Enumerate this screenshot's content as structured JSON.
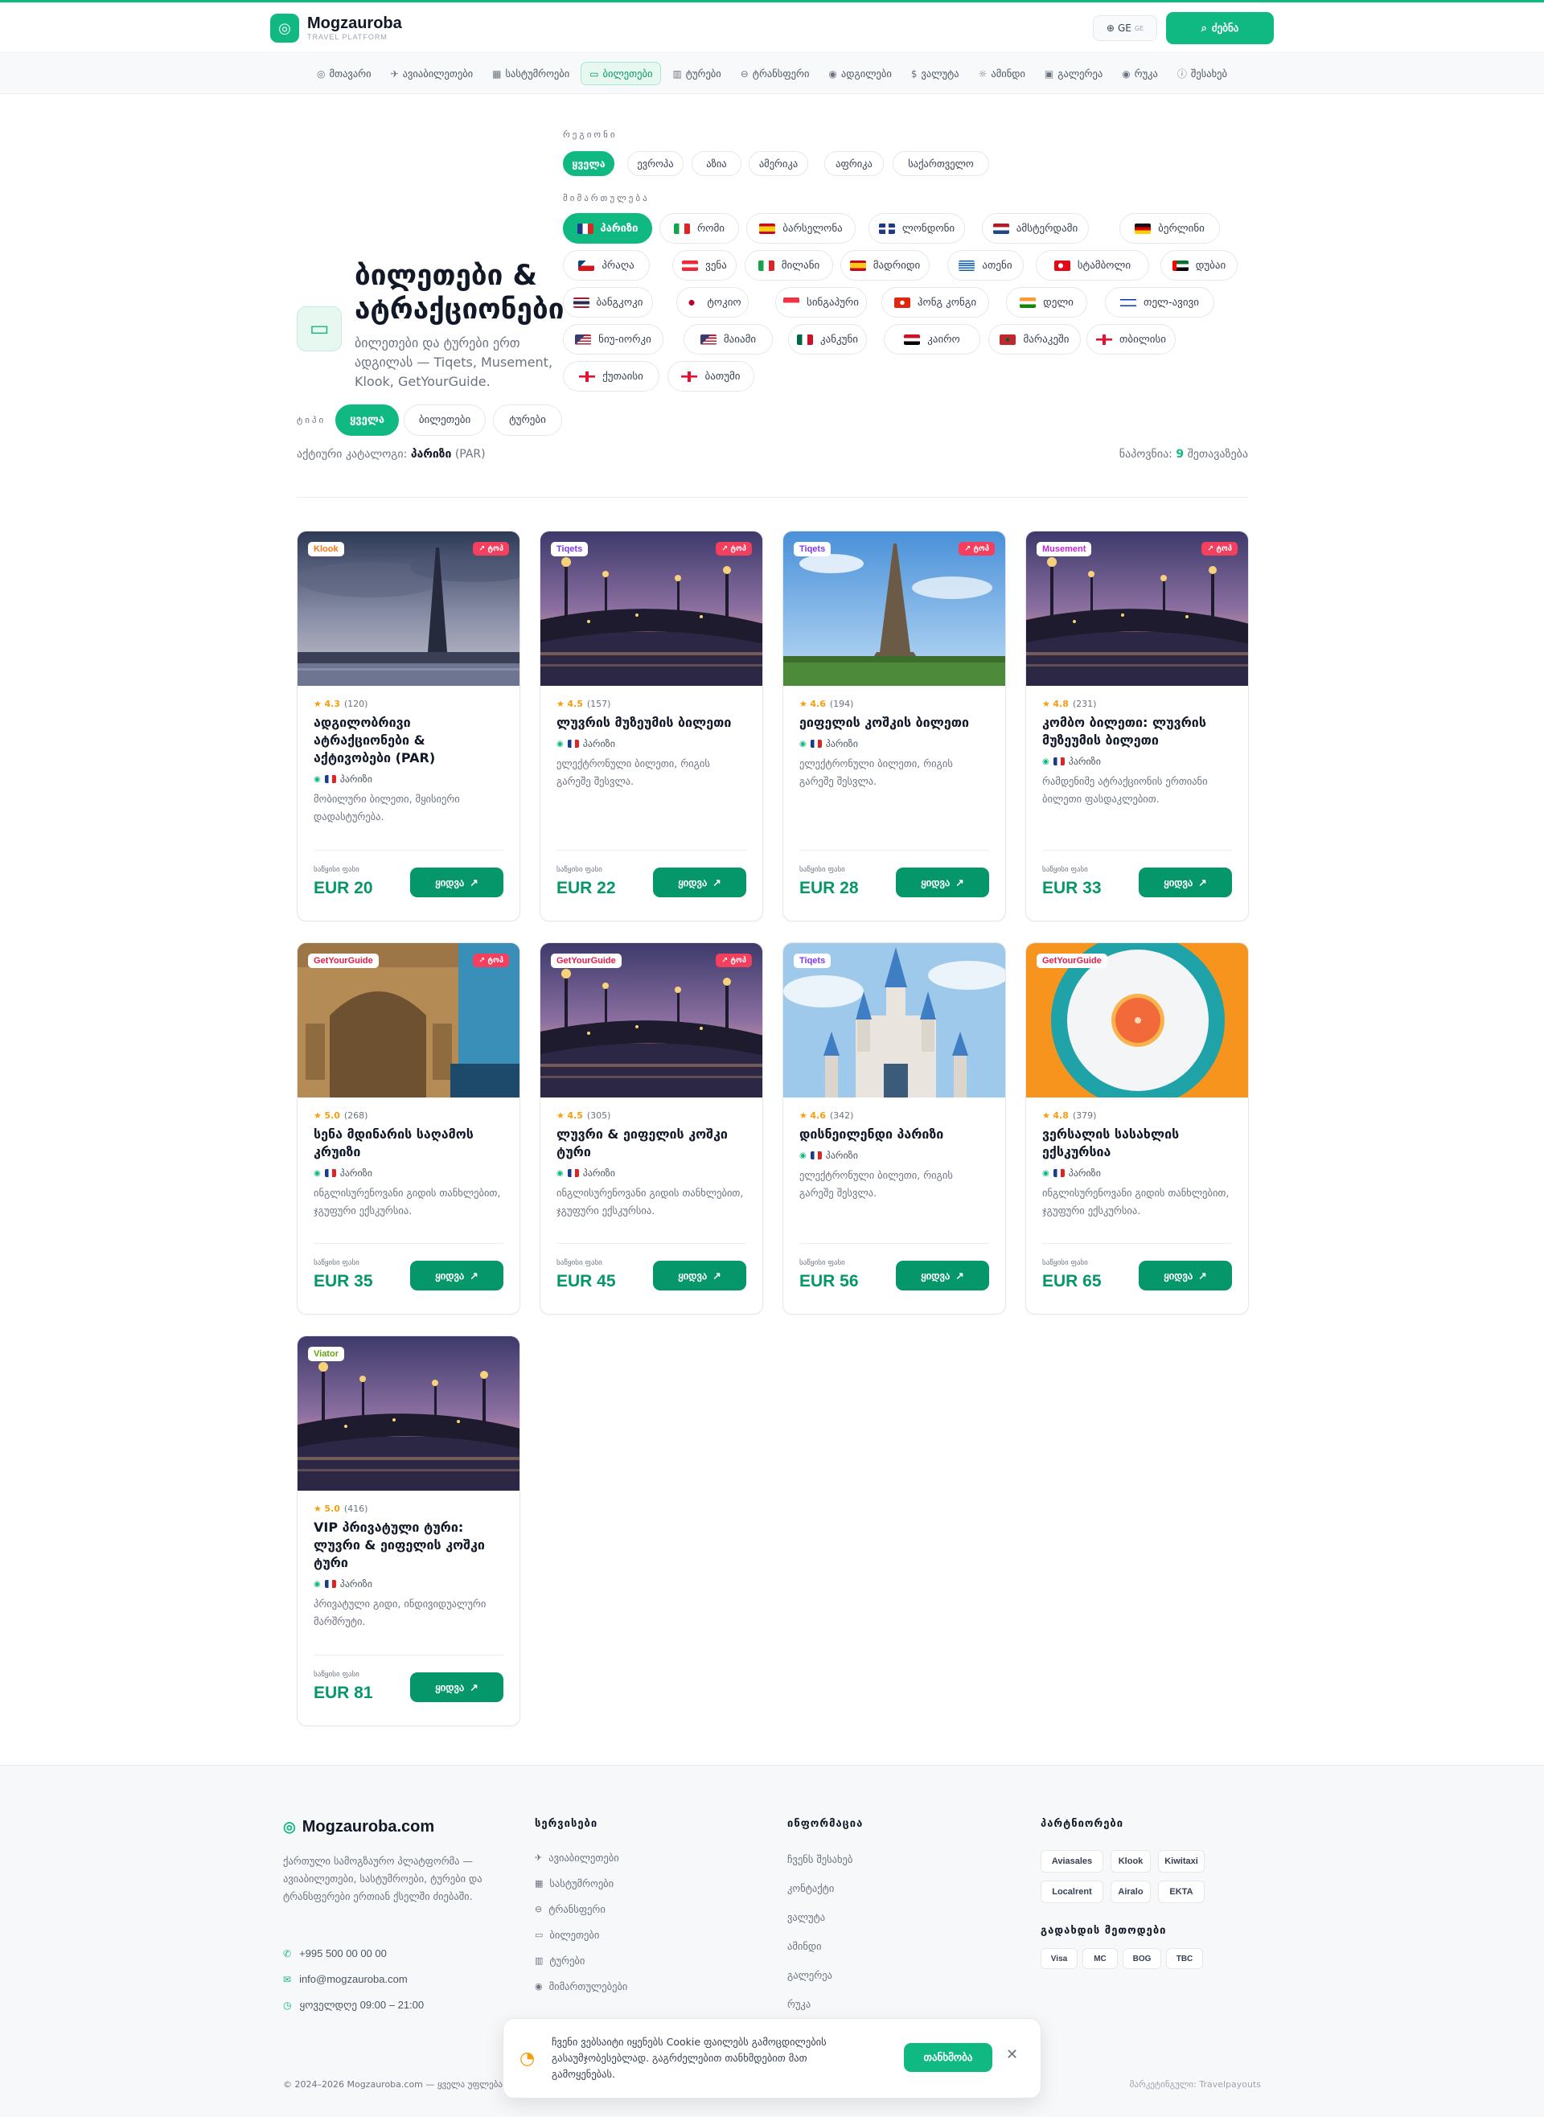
{
  "header": {
    "logo_name": "Mogzauroba",
    "logo_sub": "TRAVEL PLATFORM",
    "lang": "GE",
    "lang_sub": "GE",
    "search_label": "ძებნა"
  },
  "nav": [
    {
      "label": "მთავარი",
      "icon": "compass-icon",
      "glyph": "◎"
    },
    {
      "label": "ავიაბილეთები",
      "icon": "plane-icon",
      "glyph": "✈"
    },
    {
      "label": "სასტუმროები",
      "icon": "building-icon",
      "glyph": "▦"
    },
    {
      "label": "ბილეთები",
      "icon": "ticket-icon",
      "glyph": "▭",
      "active": true
    },
    {
      "label": "ტურები",
      "icon": "map-icon",
      "glyph": "▥"
    },
    {
      "label": "ტრანსფერი",
      "icon": "car-icon",
      "glyph": "⊖"
    },
    {
      "label": "ადგილები",
      "icon": "pin-icon",
      "glyph": "◉"
    },
    {
      "label": "ვალუტა",
      "icon": "currency-icon",
      "glyph": "$"
    },
    {
      "label": "ამინდი",
      "icon": "weather-icon",
      "glyph": "☼"
    },
    {
      "label": "გალერეა",
      "icon": "image-icon",
      "glyph": "▣"
    },
    {
      "label": "რუკა",
      "icon": "location-icon",
      "glyph": "◉"
    },
    {
      "label": "შესახებ",
      "icon": "info-icon",
      "glyph": "ⓘ"
    }
  ],
  "hero": {
    "title": "ბილეთები & ატრაქციონები",
    "subtitle": "ბილეთები და ტურები ერთ ადგილას — Tiqets, Musement, Klook, GetYourGuide."
  },
  "filters": {
    "region_label": "რეგიონი",
    "regions": [
      "ყველა",
      "ევროპა",
      "აზია",
      "ამერიკა",
      "აფრიკა",
      "საქართველო"
    ],
    "region_active": 0,
    "destination_label": "მიმართულება",
    "destinations": [
      {
        "label": "პარიზი",
        "flag": "fr",
        "active": true
      },
      {
        "label": "რომი",
        "flag": "it"
      },
      {
        "label": "ბარსელონა",
        "flag": "es"
      },
      {
        "label": "ლონდონი",
        "flag": "gb"
      },
      {
        "label": "ამსტერდამი",
        "flag": "nl"
      },
      {
        "label": "ბერლინი",
        "flag": "de"
      },
      {
        "label": "პრაღა",
        "flag": "cz"
      },
      {
        "label": "ვენა",
        "flag": "at"
      },
      {
        "label": "მილანი",
        "flag": "it"
      },
      {
        "label": "მადრიდი",
        "flag": "es"
      },
      {
        "label": "ათენი",
        "flag": "gr"
      },
      {
        "label": "სტამბოლი",
        "flag": "tr"
      },
      {
        "label": "დუბაი",
        "flag": "ae"
      },
      {
        "label": "ბანგკოკი",
        "flag": "th"
      },
      {
        "label": "ტოკიო",
        "flag": "jp"
      },
      {
        "label": "სინგაპური",
        "flag": "sg"
      },
      {
        "label": "ჰონგ კონგი",
        "flag": "hk"
      },
      {
        "label": "დელი",
        "flag": "in"
      },
      {
        "label": "თელ-ავივი",
        "flag": "il"
      },
      {
        "label": "ნიუ-იორკი",
        "flag": "us"
      },
      {
        "label": "მაიამი",
        "flag": "us"
      },
      {
        "label": "კანკუნი",
        "flag": "mx"
      },
      {
        "label": "კაირო",
        "flag": "eg"
      },
      {
        "label": "მარაკეში",
        "flag": "ma"
      },
      {
        "label": "თბილისი",
        "flag": "ge"
      },
      {
        "label": "ქუთაისი",
        "flag": "ge"
      },
      {
        "label": "ბათუმი",
        "flag": "ge"
      }
    ],
    "type_label": "ტიპი",
    "types": [
      "ყველა",
      "ბილეთები",
      "ტურები"
    ],
    "type_active": 0
  },
  "catalog": {
    "active_prefix": "აქტიური კატალოგი:",
    "active_city": "პარიზი",
    "active_code": "(PAR)",
    "found_prefix": "ნაპოვნია:",
    "found_count": "9",
    "found_suffix": "შეთავაზება"
  },
  "card_labels": {
    "price_label": "საწყისი ფასი",
    "book_label": "ყიდვა",
    "top_label": "ტოპ",
    "location": "პარიზი"
  },
  "cards": [
    {
      "provider": "Klook",
      "provider_color": "#f97316",
      "top": true,
      "rating": "4.3",
      "reviews": "(120)",
      "title": "ადგილობრივი ატრაქციონები & აქტივობები (PAR)",
      "desc": "მობილური ბილეთი, მყისიერი დადასტურება.",
      "price": "EUR 20",
      "scene": "eiffel-dusk"
    },
    {
      "provider": "Tiqets",
      "provider_color": "#7c3aed",
      "top": true,
      "rating": "4.5",
      "reviews": "(157)",
      "title": "ლუვრის მუზეუმის ბილეთი",
      "desc": "ელექტრონული ბილეთი, რიგის გარეშე შესვლა.",
      "price": "EUR 22",
      "scene": "bridge-dusk"
    },
    {
      "provider": "Tiqets",
      "provider_color": "#7c3aed",
      "top": true,
      "rating": "4.6",
      "reviews": "(194)",
      "title": "ეიფელის კოშკის ბილეთი",
      "desc": "ელექტრონული ბილეთი, რიგის გარეშე შესვლა.",
      "price": "EUR 28",
      "scene": "eiffel-day"
    },
    {
      "provider": "Musement",
      "provider_color": "#c026d3",
      "top": true,
      "rating": "4.8",
      "reviews": "(231)",
      "title": "კომბო ბილეთი: ლუვრის მუზეუმის ბილეთი",
      "desc": "რამდენიმე ატრაქციონის ერთიანი ბილეთი ფასდაკლებით.",
      "price": "EUR 33",
      "scene": "bridge-dusk"
    },
    {
      "provider": "GetYourGuide",
      "provider_color": "#e11d48",
      "top": true,
      "rating": "5.0",
      "reviews": "(268)",
      "title": "სენა მდინარის საღამოს კრუიზი",
      "desc": "ინგლისურენოვანი გიდის თანხლებით, ჯგუფური ექსკურსია.",
      "price": "EUR 35",
      "scene": "arc"
    },
    {
      "provider": "GetYourGuide",
      "provider_color": "#e11d48",
      "top": true,
      "rating": "4.5",
      "reviews": "(305)",
      "title": "ლუვრი & ეიფელის კოშკი ტური",
      "desc": "ინგლისურენოვანი გიდის თანხლებით, ჯგუფური ექსკურსია.",
      "price": "EUR 45",
      "scene": "bridge-dusk"
    },
    {
      "provider": "Tiqets",
      "provider_color": "#7c3aed",
      "top": false,
      "rating": "4.6",
      "reviews": "(342)",
      "title": "დისნეილენდი პარიზი",
      "desc": "ელექტრონული ბილეთი, რიგის გარეშე შესვლა.",
      "price": "EUR 56",
      "scene": "castle"
    },
    {
      "provider": "GetYourGuide",
      "provider_color": "#e11d48",
      "top": false,
      "rating": "4.8",
      "reviews": "(379)",
      "title": "ვერსალის სასახლის ექსკურსია",
      "desc": "ინგლისურენოვანი გიდის თანხლებით, ჯგუფური ექსკურსია.",
      "price": "EUR 65",
      "scene": "grapefruit"
    },
    {
      "provider": "Viator",
      "provider_color": "#65a30d",
      "top": false,
      "rating": "5.0",
      "reviews": "(416)",
      "title": "VIP პრივატული ტური: ლუვრი & ეიფელის კოშკი ტური",
      "desc": "პრივატული გიდი, ინდივიდუალური მარშრუტი.",
      "price": "EUR 81",
      "scene": "bridge-dusk"
    }
  ],
  "footer": {
    "brand": "Mogzauroba.com",
    "desc": "ქართული სამოგზაურო პლატფორმა — ავიაბილეთები, სასტუმროები, ტურები და ტრანსფერები ერთიან ქსელში ძიებაში.",
    "phone": "+995 500 00 00 00",
    "email": "info@mogzauroba.com",
    "hours": "ყოველდღე 09:00 – 21:00",
    "services_head": "სერვისები",
    "services": [
      {
        "label": "ავიაბილეთები",
        "icon": "plane-icon",
        "glyph": "✈"
      },
      {
        "label": "სასტუმროები",
        "icon": "building-icon",
        "glyph": "▦"
      },
      {
        "label": "ტრანსფერი",
        "icon": "car-icon",
        "glyph": "⊖"
      },
      {
        "label": "ბილეთები",
        "icon": "ticket-icon",
        "glyph": "▭"
      },
      {
        "label": "ტურები",
        "icon": "map-icon",
        "glyph": "▥"
      },
      {
        "label": "მიმართულებები",
        "icon": "pin-icon",
        "glyph": "◉"
      }
    ],
    "info_head": "ინფორმაცია",
    "info": [
      "ჩვენს შესახებ",
      "კონტაქტი",
      "ვალუტა",
      "ამინდი",
      "გალერეა",
      "რუკა"
    ],
    "partners_head": "პარტნიორები",
    "partners": [
      "Aviasales",
      "Klook",
      "Kiwitaxi",
      "Localrent",
      "Airalo",
      "EKTA"
    ],
    "payment_head": "გადახდის მეთოდები",
    "payments": [
      "Visa",
      "MC",
      "BOG",
      "TBC"
    ],
    "copyright": "© 2024–2026 Mogzauroba.com — ყველა უფლება",
    "powered": "მარკეტინგული: Travelpayouts"
  },
  "cookie": {
    "text": "ჩვენი ვებსაიტი იყენებს Cookie ფაილებს გამოცდილების გასაუმჯობესებლად. გაგრძელებით თანხმდებით მათ გამოყენებას.",
    "accept": "თანხმობა"
  }
}
